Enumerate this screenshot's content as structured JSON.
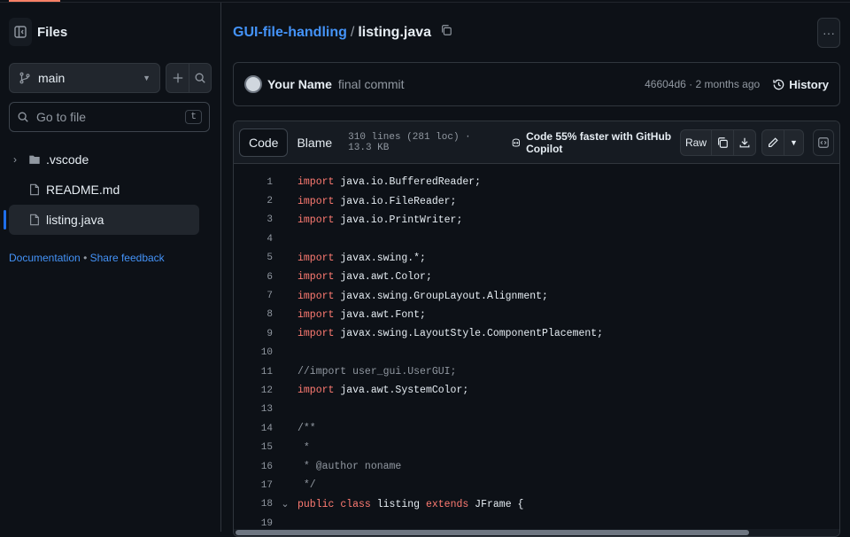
{
  "sidebar": {
    "title": "Files",
    "branch": "main",
    "goto_placeholder": "Go to file",
    "goto_shortcut": "t",
    "tree": [
      {
        "name": ".vscode",
        "type": "folder"
      },
      {
        "name": "README.md",
        "type": "file"
      },
      {
        "name": "listing.java",
        "type": "file",
        "active": true
      }
    ],
    "links": {
      "documentation": "Documentation",
      "separator": "•",
      "feedback": "Share feedback"
    }
  },
  "breadcrumb": {
    "repo": "GUI-file-handling",
    "separator": "/",
    "file": "listing.java"
  },
  "more_label": "···",
  "commit": {
    "author": "Your Name",
    "message": "final commit",
    "meta": "46604d6 · 2 months ago",
    "history_label": "History"
  },
  "file": {
    "tabs": [
      "Code",
      "Blame"
    ],
    "active_tab": "Code",
    "info": "310 lines (281 loc) · 13.3 KB",
    "copilot": "Code 55% faster with GitHub Copilot",
    "raw_label": "Raw"
  },
  "code_lines": [
    {
      "n": "1",
      "kw": "import",
      "rest": " java.io.BufferedReader;"
    },
    {
      "n": "2",
      "kw": "import",
      "rest": " java.io.FileReader;"
    },
    {
      "n": "3",
      "kw": "import",
      "rest": " java.io.PrintWriter;"
    },
    {
      "n": "4",
      "kw": "",
      "rest": ""
    },
    {
      "n": "5",
      "kw": "import",
      "rest": " javax.swing.*;"
    },
    {
      "n": "6",
      "kw": "import",
      "rest": " java.awt.Color;"
    },
    {
      "n": "7",
      "kw": "import",
      "rest": " javax.swing.GroupLayout.Alignment;"
    },
    {
      "n": "8",
      "kw": "import",
      "rest": " java.awt.Font;"
    },
    {
      "n": "9",
      "kw": "import",
      "rest": " javax.swing.LayoutStyle.ComponentPlacement;"
    },
    {
      "n": "10",
      "kw": "",
      "rest": ""
    },
    {
      "n": "11",
      "cm": "//import user_gui.UserGUI;"
    },
    {
      "n": "12",
      "kw": "import",
      "rest": " java.awt.SystemColor;"
    },
    {
      "n": "13",
      "kw": "",
      "rest": ""
    },
    {
      "n": "14",
      "cm": "/**"
    },
    {
      "n": "15",
      "cm": " *"
    },
    {
      "n": "16",
      "cm": " * @author noname"
    },
    {
      "n": "17",
      "cm": " */"
    },
    {
      "n": "18",
      "fold": "⌄",
      "parts": [
        [
          "kw",
          "public"
        ],
        [
          "txt",
          " "
        ],
        [
          "kw",
          "class"
        ],
        [
          "txt",
          " listing "
        ],
        [
          "kw",
          "extends"
        ],
        [
          "txt",
          " JFrame {"
        ]
      ]
    },
    {
      "n": "19",
      "kw": "",
      "rest": ""
    }
  ],
  "colors": {
    "keyword": "#ff7b72",
    "link": "#4493f8",
    "accent": "#f78166"
  }
}
